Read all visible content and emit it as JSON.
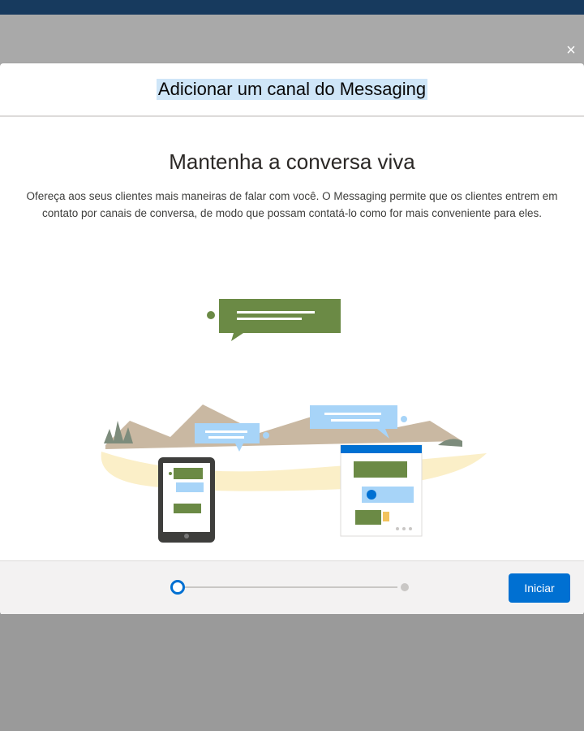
{
  "modal": {
    "close_glyph": "×",
    "title": "Adicionar um canal do Messaging"
  },
  "content": {
    "heading": "Mantenha a conversa viva",
    "description": "Ofereça aos seus clientes mais maneiras de falar com você. O Messaging permite que os clientes entrem em contato por canais de conversa, de modo que possam contatá-lo como for mais conveniente para eles."
  },
  "footer": {
    "primary_label": "Iniciar",
    "progress": {
      "current_step": 1,
      "total_steps": 2
    }
  },
  "colors": {
    "accent": "#0070d2",
    "bubble_green": "#6b8a45",
    "bubble_blue": "#a7d4f8"
  },
  "icons": [
    "close-icon",
    "tablet-icon",
    "chat-window-icon",
    "thumbs-up-icon"
  ]
}
